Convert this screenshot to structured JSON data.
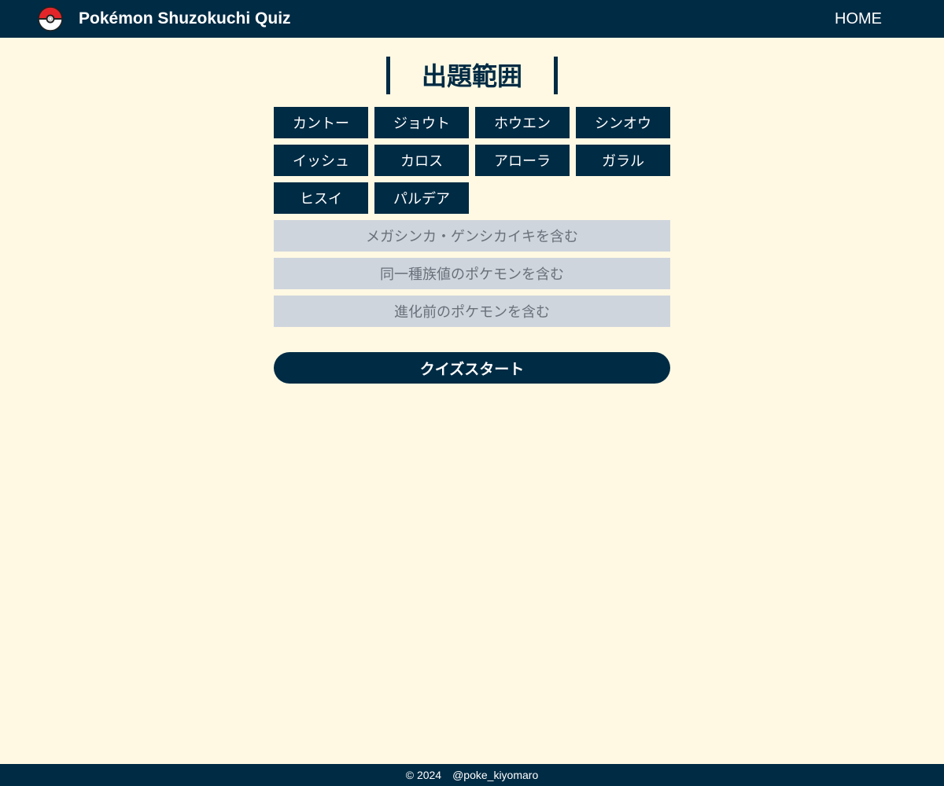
{
  "navbar": {
    "brand": "Pokémon Shuzokuchi Quiz",
    "brand_logo_icon": "pokeball-icon",
    "home_link": "HOME"
  },
  "main": {
    "heading": "出題範囲",
    "regions": [
      "カントー",
      "ジョウト",
      "ホウエン",
      "シンオウ",
      "イッシュ",
      "カロス",
      "アローラ",
      "ガラル",
      "ヒスイ",
      "パルデア"
    ],
    "options": [
      "メガシンカ・ゲンシカイキを含む",
      "同一種族値のポケモンを含む",
      "進化前のポケモンを含む"
    ],
    "start_button": "クイズスタート"
  },
  "footer": {
    "copyright": "© 2024",
    "handle": "@poke_kiyomaro"
  },
  "colors": {
    "navy": "#002b44",
    "background": "#fff9e3",
    "option_inactive_bg": "#cfd5dd",
    "option_inactive_text": "#697079"
  }
}
